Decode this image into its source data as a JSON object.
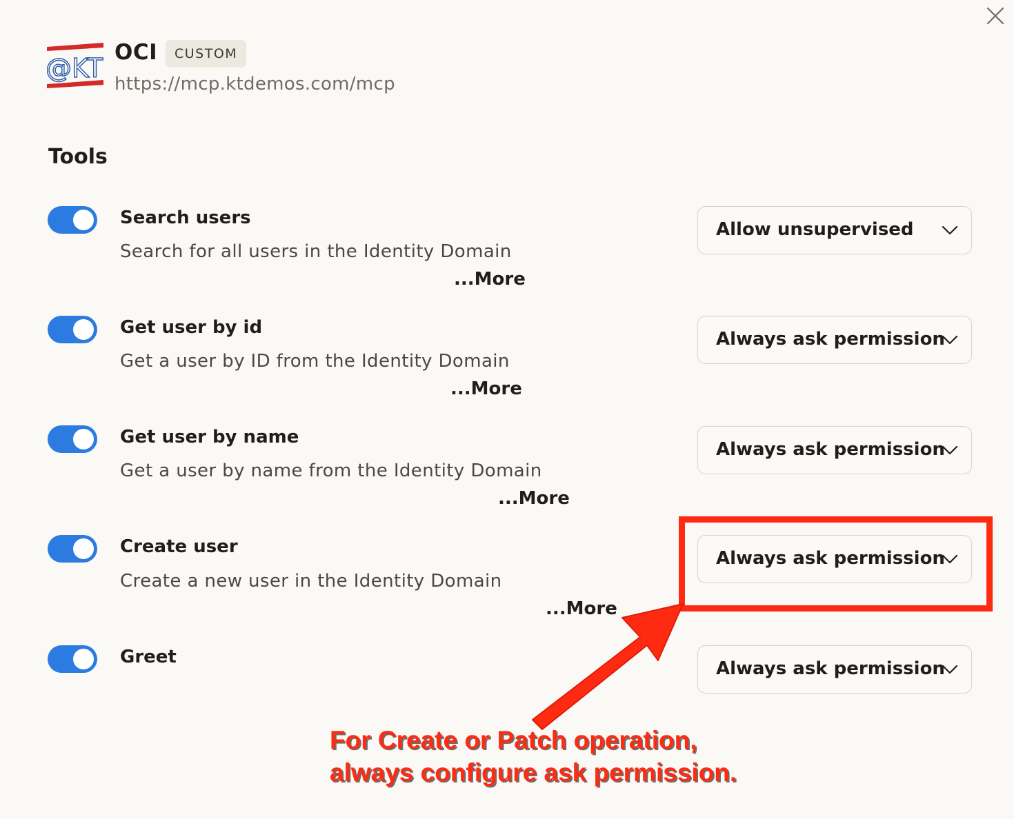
{
  "header": {
    "logo_text": "@KT",
    "title": "OCI",
    "badge": "CUSTOM",
    "url": "https://mcp.ktdemos.com/mcp",
    "close_icon": "close-icon"
  },
  "tools_section": {
    "heading": "Tools",
    "items": [
      {
        "name": "Search users",
        "description": "Search for all users in the Identity Domain",
        "more": "...More",
        "enabled": true,
        "permission": "Allow unsupervised"
      },
      {
        "name": "Get user by id",
        "description": "Get a user by ID from the Identity Domain",
        "more": "...More",
        "enabled": true,
        "permission": "Always ask permission"
      },
      {
        "name": "Get user by name",
        "description": "Get a user by name from the Identity Domain",
        "more": "...More",
        "enabled": true,
        "permission": "Always ask permission"
      },
      {
        "name": "Create user",
        "description": "Create a new user in the Identity Domain",
        "more": "...More",
        "enabled": true,
        "permission": "Always ask permission"
      },
      {
        "name": "Greet",
        "enabled": true,
        "permission": "Always ask permission"
      }
    ]
  },
  "annotation": {
    "line1": "For Create or Patch operation,",
    "line2": "always configure ask permission.",
    "color": "#ff2a12"
  },
  "colors": {
    "toggle_on": "#2c7be0",
    "background": "#faf9f5",
    "annotation_red": "#ff2a12"
  }
}
